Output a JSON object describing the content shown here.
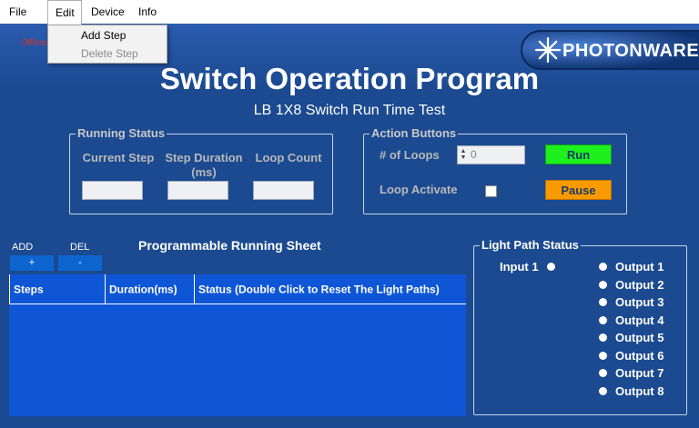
{
  "menubar": {
    "items": [
      {
        "label": "File"
      },
      {
        "label": "Edit"
      },
      {
        "label": "Device"
      },
      {
        "label": "Info"
      }
    ],
    "edit_dropdown": [
      {
        "label": "Add Step",
        "enabled": true
      },
      {
        "label": "Delete Step",
        "enabled": false
      }
    ]
  },
  "status": {
    "connection": "Offline"
  },
  "brand": {
    "logo_text": "PHOTONWARES"
  },
  "header": {
    "title": "Switch Operation Program",
    "subtitle": "LB 1X8 Switch Run Time Test"
  },
  "running_status": {
    "group_label": "Running Status",
    "columns": [
      {
        "label": "Current Step",
        "value": ""
      },
      {
        "label": "Step Duration (ms)",
        "value": ""
      },
      {
        "label": "Loop Count",
        "value": ""
      }
    ]
  },
  "action_buttons": {
    "group_label": "Action Buttons",
    "loops_label": "# of Loops",
    "loops_value": "0",
    "loop_activate_label": "Loop Activate",
    "loop_activate_checked": false,
    "run_label": "Run",
    "pause_label": "Pause"
  },
  "sheet": {
    "add_label": "ADD",
    "del_label": "DEL",
    "add_button": "+",
    "del_button": "-",
    "title": "Programmable Running Sheet",
    "columns": [
      {
        "label": "Steps"
      },
      {
        "label": "Duration(ms)"
      },
      {
        "label": "Status (Double Click to Reset The Light Paths)"
      }
    ],
    "rows": []
  },
  "light_path": {
    "group_label": "Light Path Status",
    "input_label": "Input 1",
    "outputs": [
      "Output 1",
      "Output 2",
      "Output 3",
      "Output 4",
      "Output 5",
      "Output 6",
      "Output 7",
      "Output 8"
    ]
  },
  "colors": {
    "background": "#1b4a90",
    "grid": "#0f56d6",
    "run": "#1ef01e",
    "pause": "#f99b00",
    "offline": "#d43030"
  },
  "icons": {
    "logo": "star-burst-icon",
    "led": "circle-indicator-icon",
    "spinner": "up-down-arrows-icon"
  }
}
